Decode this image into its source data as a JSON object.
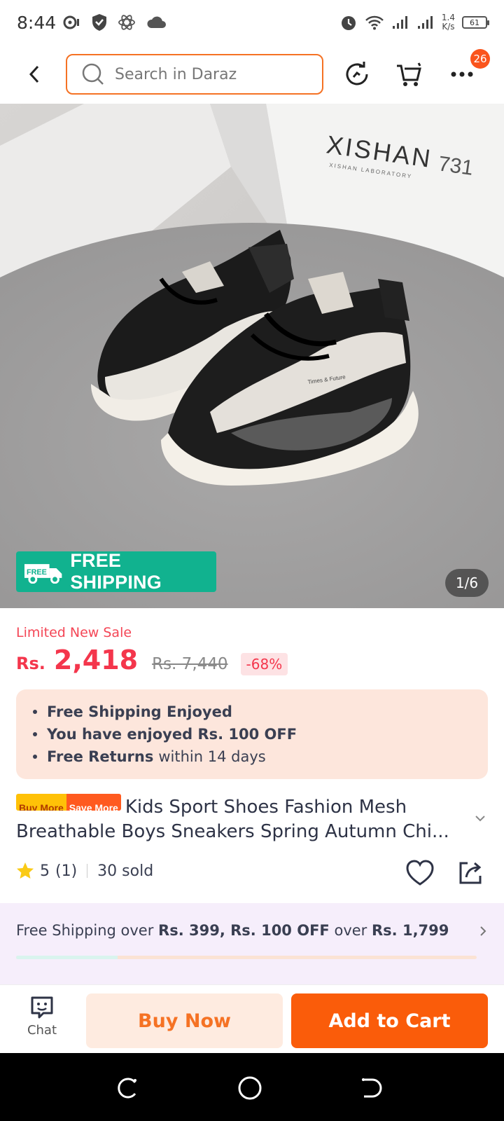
{
  "status_bar": {
    "time": "8:44",
    "net_speed": "1.4",
    "net_speed_unit": "K/s",
    "battery": "61"
  },
  "search": {
    "placeholder": "Search in Daraz"
  },
  "header": {
    "more_badge": "26"
  },
  "gallery": {
    "image_brand_text": "XISHAN",
    "image_brand_number": "731",
    "image_brand_subtext": "XISHAN LABORATORY",
    "shoe_print_text": "Times & Future",
    "free_shipping_badge": "FREE SHIPPING",
    "free_truck_label": "FREE",
    "counter": "1/6"
  },
  "price": {
    "sale_label": "Limited New Sale",
    "currency": "Rs.",
    "current": "2,418",
    "original": "Rs. 7,440",
    "discount": "-68%"
  },
  "perks": [
    {
      "bold": "Free Shipping Enjoyed",
      "rest": ""
    },
    {
      "bold": "You have enjoyed Rs. 100 OFF",
      "rest": ""
    },
    {
      "bold": "Free Returns",
      "rest": "within 14 days"
    }
  ],
  "product": {
    "tag_a": "Buy More",
    "tag_b": "Save More",
    "title": "Kids Sport Shoes Fashion Mesh Breathable Boys Sneakers Spring Autumn Chi...",
    "rating": "5",
    "rating_count": "(1)",
    "sold": "30 sold"
  },
  "promo": {
    "p1": "Free Shipping over",
    "b1": "Rs. 399, Rs. 100 OFF",
    "p2": "over",
    "b2": "Rs. 1,799",
    "progress": 0.22
  },
  "bottom": {
    "chat_label": "Chat",
    "buy_now": "Buy Now",
    "add_to_cart": "Add to Cart"
  },
  "colors": {
    "accent": "#f57224",
    "price_red": "#f4364c",
    "free_shipping_green": "#11b28f",
    "add_to_cart_bg": "#fa5c0a"
  }
}
